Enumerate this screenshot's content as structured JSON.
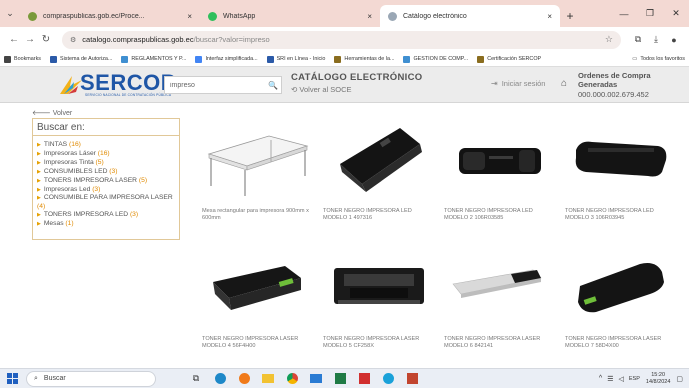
{
  "browser": {
    "tabs": [
      {
        "title": "compraspublicas.gob.ec/Proce...",
        "close": "×",
        "favicon_color": "#7a9a3a",
        "active": false
      },
      {
        "title": "WhatsApp",
        "close": "×",
        "favicon_color": "#2fbf5c",
        "active": false
      },
      {
        "title": "Catálogo electrónico",
        "close": "×",
        "favicon_color": "#9aa7b5",
        "active": true
      }
    ],
    "new_tab": "+",
    "url_host": "catalogo.compraspublicas.gob.ec",
    "url_path": "/buscar?valor=impreso",
    "bookmarks": [
      {
        "label": "Bookmarks",
        "color": "#444"
      },
      {
        "label": "Sistema de Autoriza...",
        "color": "#2b5aa8"
      },
      {
        "label": "REGLAMENTOS Y P...",
        "color": "#3f8fd1"
      },
      {
        "label": "Interfaz simplificada...",
        "color": "#4285f4"
      },
      {
        "label": "SRI en Línea - Inicio",
        "color": "#2b5aa8"
      },
      {
        "label": "Herramientas de la...",
        "color": "#8a6d1f"
      },
      {
        "label": "GESTION DE COMP...",
        "color": "#3f8fd1"
      },
      {
        "label": "Certificación SERCOP",
        "color": "#8a6d1f"
      }
    ],
    "bookmarks_right": "Todos los favoritos"
  },
  "header": {
    "brand": "SERCOP",
    "brand_sub": "SERVICIO NACIONAL DE CONTRATACIÓN PÚBLICA",
    "search_value": "impreso",
    "catalog_title": "CATÁLOGO ELECTRÓNICO",
    "back_soce": "Volver al SOCE",
    "login": "Iniciar sesión",
    "orders_label": "Ordenes de Compra Generadas",
    "orders_value": "000.000.002.679.452"
  },
  "sidebar": {
    "back": "Volver",
    "title": "Buscar en:",
    "items": [
      {
        "label": "TINTAS",
        "count": "(16)"
      },
      {
        "label": "Impresoras Láser",
        "count": "(16)"
      },
      {
        "label": "Impresoras Tinta",
        "count": "(5)"
      },
      {
        "label": "CONSUMIBLES LED",
        "count": "(3)"
      },
      {
        "label": "TONERS IMPRESORA LASER",
        "count": "(5)"
      },
      {
        "label": "Impresoras Led",
        "count": "(3)"
      },
      {
        "label": "CONSUMIBLE PARA IMPRESORA LASER",
        "count": "(4)"
      },
      {
        "label": "TONERS IMPRESORA LED",
        "count": "(3)"
      },
      {
        "label": "Mesas",
        "count": "(1)"
      }
    ]
  },
  "products": [
    {
      "caption": "Mesa rectangular para impresora 900mm x 600mm",
      "kind": "table"
    },
    {
      "caption": "TONER NEGRO IMPRESORA LED MODELO 1 497316",
      "kind": "toner-a"
    },
    {
      "caption": "TONER NEGRO IMPRESORA LED MODELO 2 106R03585",
      "kind": "toner-b"
    },
    {
      "caption": "TONER NEGRO IMPRESORA LED MODELO 3 106R03945",
      "kind": "toner-c"
    },
    {
      "caption": "TONER NEGRO IMPRESORA LASER MODELO 4 56F4H00",
      "kind": "toner-d"
    },
    {
      "caption": "TONER NEGRO IMPRESORA LASER MODELO 5 CF258X",
      "kind": "toner-e"
    },
    {
      "caption": "TONER NEGRO IMPRESORA LASER MODELO 6 842141",
      "kind": "toner-f"
    },
    {
      "caption": "TONER NEGRO IMPRESORA LASER MODELO 7 58D4X00",
      "kind": "toner-g"
    }
  ],
  "taskbar": {
    "search": "Buscar",
    "lang": "ESP",
    "time": "15:20",
    "date": "14/8/2024"
  }
}
